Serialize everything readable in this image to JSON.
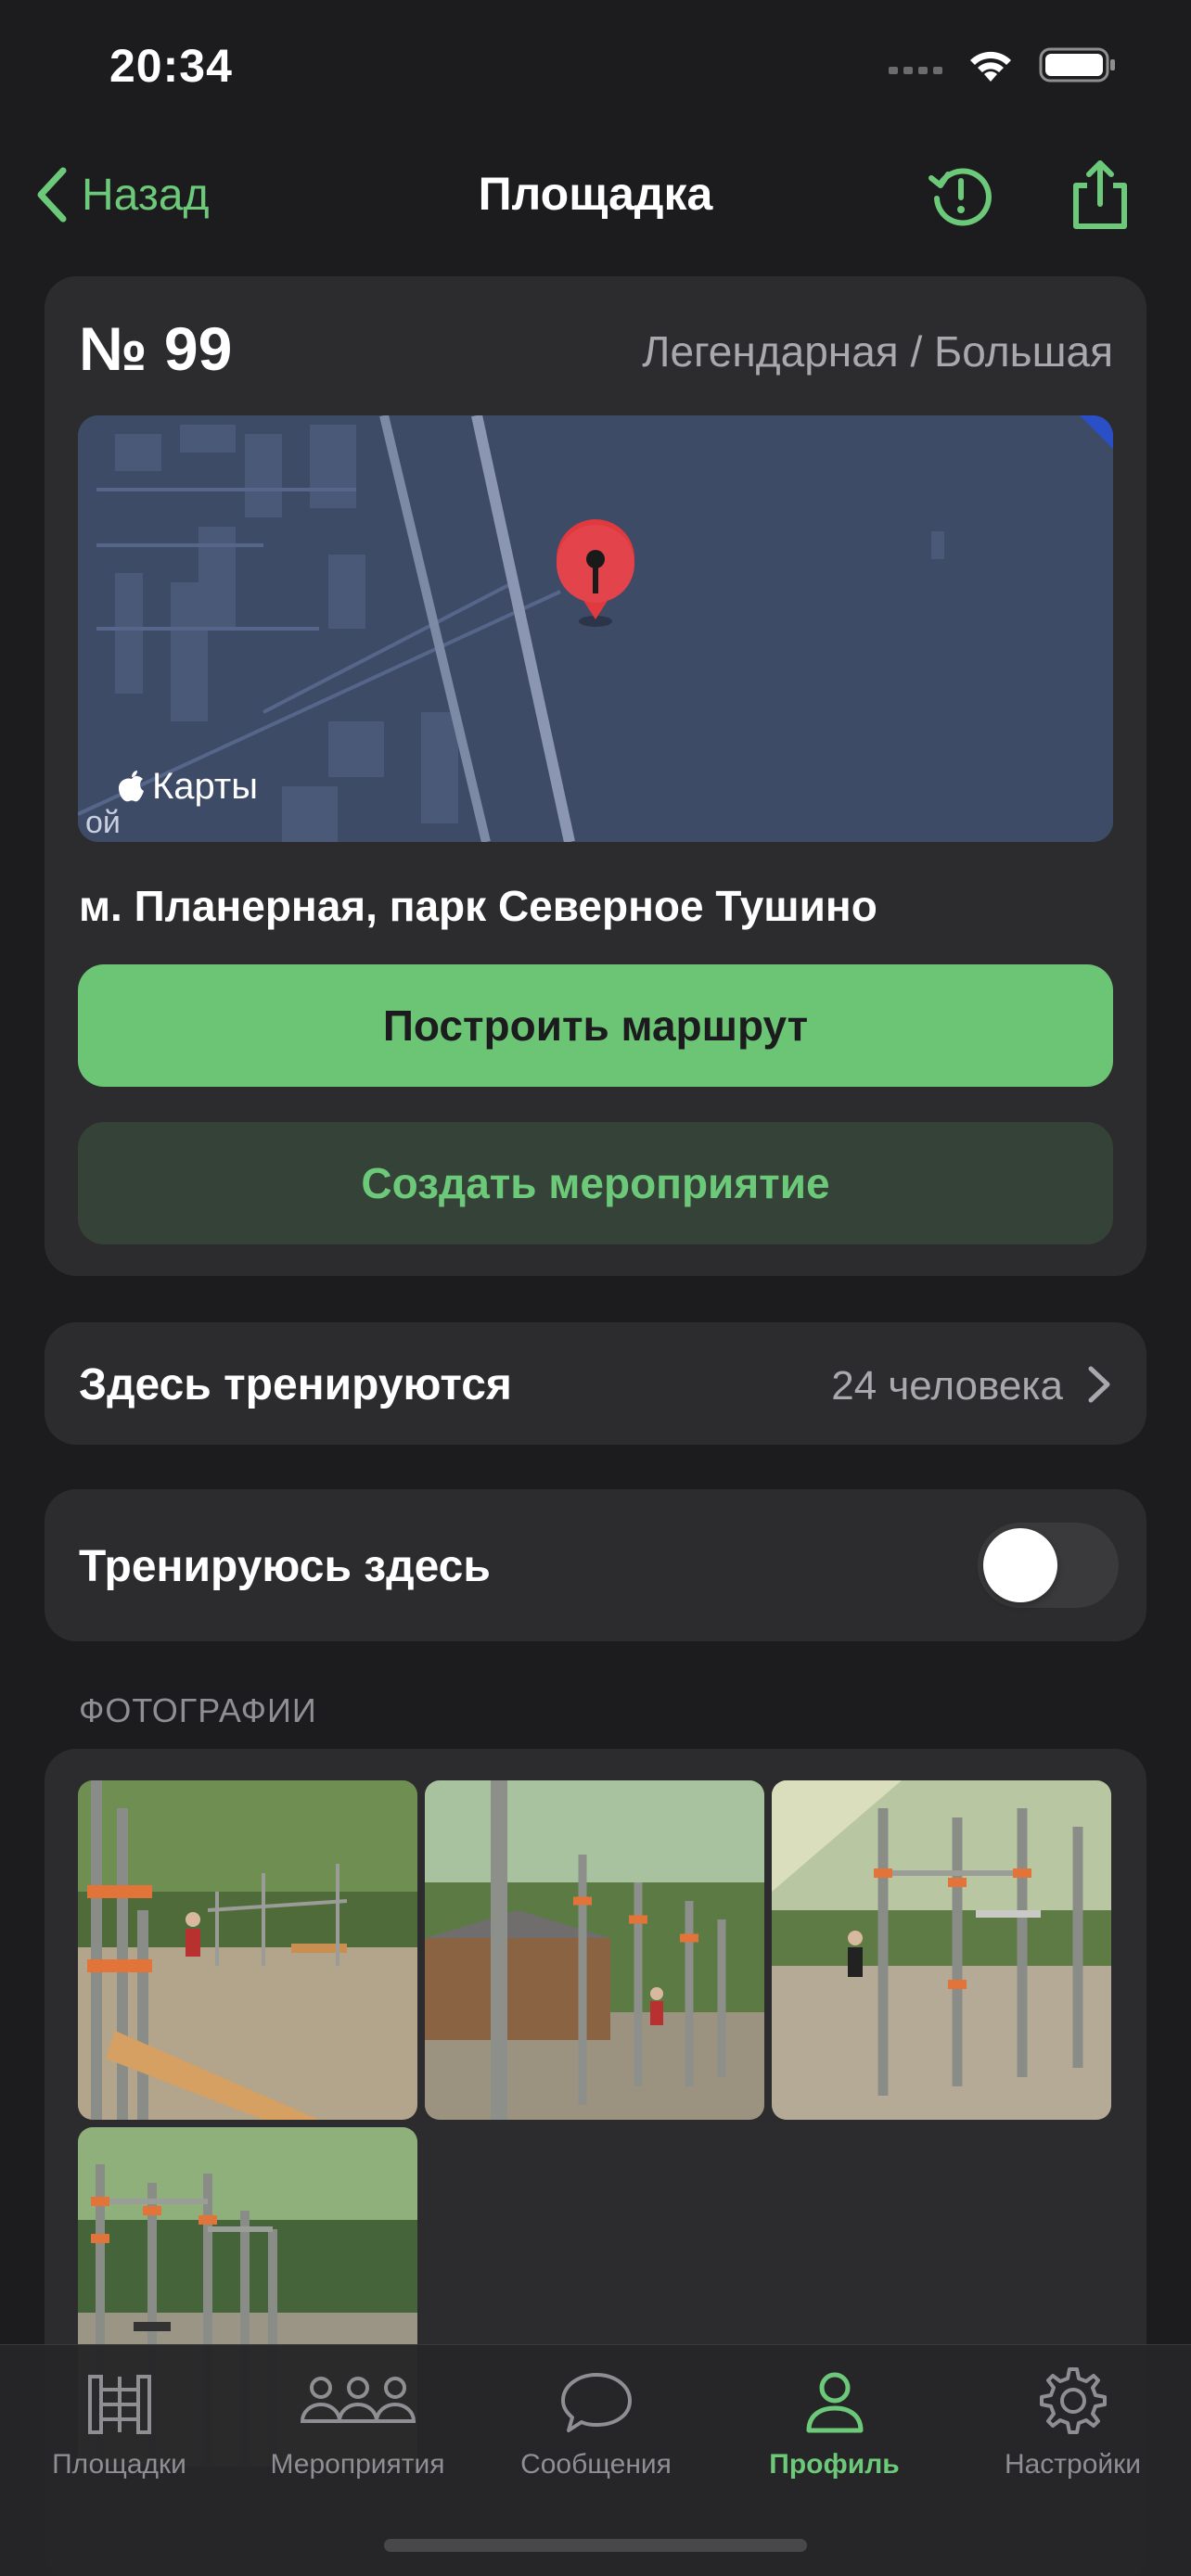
{
  "status_bar": {
    "time": "20:34"
  },
  "nav": {
    "back_label": "Назад",
    "title": "Площадка",
    "history_icon": "clock-alert-icon",
    "share_icon": "share-icon"
  },
  "park": {
    "number": "№ 99",
    "type": "Легендарная / Большая",
    "map_label": "Карты",
    "map_street_fragment": "ой",
    "address": "м. Планерная, парк Северное Тушино",
    "route_button": "Построить маршрут",
    "event_button": "Создать мероприятие"
  },
  "trainees": {
    "label": "Здесь тренируются",
    "count": "24 человека"
  },
  "train_here": {
    "label": "Тренируюсь здесь",
    "enabled": false
  },
  "photos": {
    "header": "ФОТОГРАФИИ",
    "count": 4
  },
  "tab_bar": {
    "items": [
      {
        "label": "Площадки",
        "icon": "ladder-icon",
        "active": false
      },
      {
        "label": "Мероприятия",
        "icon": "people-icon",
        "active": false
      },
      {
        "label": "Сообщения",
        "icon": "chat-bubble-icon",
        "active": false
      },
      {
        "label": "Профиль",
        "icon": "person-icon",
        "active": true
      },
      {
        "label": "Настройки",
        "icon": "gear-icon",
        "active": false
      }
    ]
  },
  "colors": {
    "accent": "#6cc97a",
    "background": "#1c1c1e",
    "card": "#2c2c2e"
  }
}
